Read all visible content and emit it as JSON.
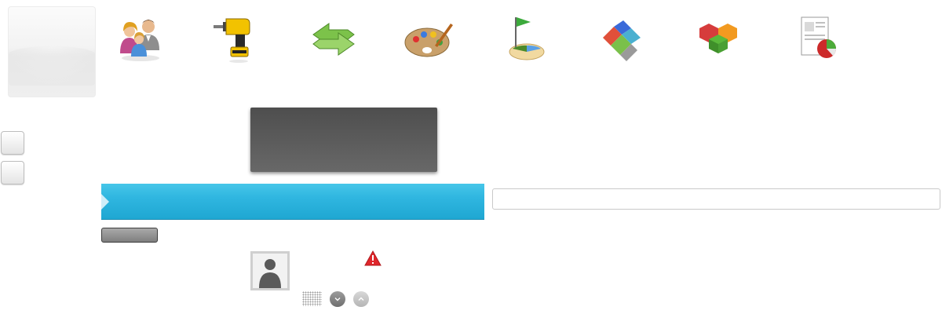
{
  "toolbar": {
    "icons": [
      {
        "name": "users-icon"
      },
      {
        "name": "drill-icon"
      },
      {
        "name": "sync-arrows-icon"
      },
      {
        "name": "palette-icon"
      },
      {
        "name": "golf-flag-icon"
      },
      {
        "name": "blocks-icon"
      },
      {
        "name": "cubes-icon"
      },
      {
        "name": "report-icon"
      }
    ]
  },
  "search": {
    "value": "",
    "placeholder": ""
  },
  "colors": {
    "accent": "#2fb6e0",
    "warning": "#e0262b",
    "dark_panel": "#5a5a5a"
  }
}
